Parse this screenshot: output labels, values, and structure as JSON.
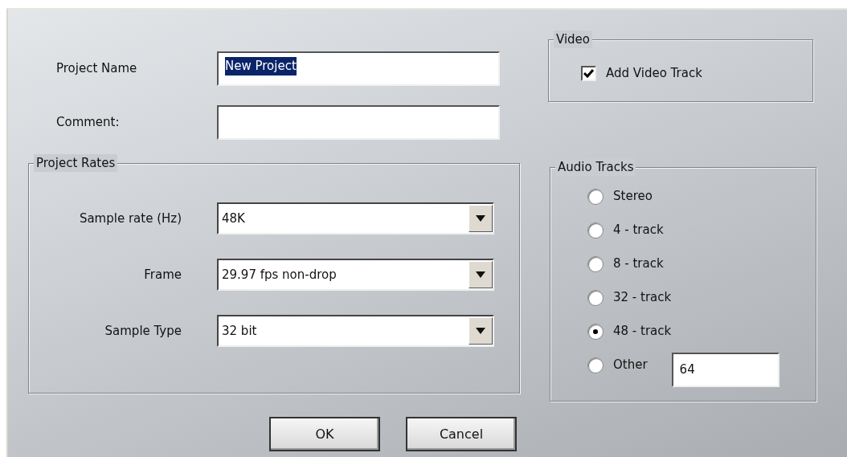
{
  "project_fields": [
    {
      "label": "Project Name",
      "value": "New Project",
      "text_selected": true
    },
    {
      "label": "Comment:"
    }
  ],
  "video": {
    "title": "Video",
    "checkbox": {
      "label": "Add Video Track",
      "checked": true
    }
  },
  "project_rates": {
    "title": "Project Rates",
    "rows": [
      {
        "label": "Sample rate (Hz)",
        "value": "48K"
      },
      {
        "label": "Frame",
        "value": "29.97 fps non-drop"
      },
      {
        "label": "Sample Type",
        "value": "32 bit"
      }
    ]
  },
  "audio_tracks": {
    "title": "Audio Tracks",
    "options": [
      {
        "label": "Stereo",
        "selected": false
      },
      {
        "label": "4 - track",
        "selected": false
      },
      {
        "label": "8 - track",
        "selected": false
      },
      {
        "label": "32 - track",
        "selected": false
      },
      {
        "label": "48 - track",
        "selected": true
      },
      {
        "label": "Other",
        "selected": false,
        "value": "64"
      }
    ]
  },
  "buttons": [
    {
      "label": "OK"
    },
    {
      "label": "Cancel"
    }
  ]
}
